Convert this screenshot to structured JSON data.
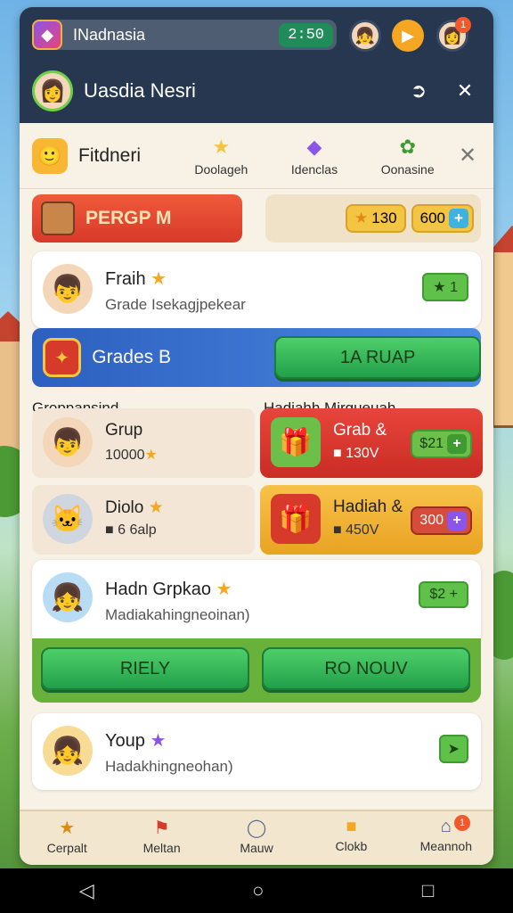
{
  "header": {
    "search_text": "INadnasia",
    "timer": "2:50",
    "notif_count": "1",
    "user_name": "Uasdia Nesri"
  },
  "tabs": {
    "main": "Fitdneri",
    "items": [
      "Doolageh",
      "Idenclas",
      "Oonasine"
    ]
  },
  "banner": {
    "group_label": "PERGP M",
    "stars": "130",
    "coins": "600"
  },
  "card1": {
    "name": "Fraih",
    "subtitle": "Grade Isekagjpekear",
    "badge": "1"
  },
  "strip": {
    "label": "Grades B",
    "button": "1A RUAP"
  },
  "sections": {
    "left": "Groppansind",
    "right": "Hadiahh Mirgueuah"
  },
  "grid": {
    "grup_title": "Grup",
    "grup_value": "10000",
    "diolo_title": "Diolo",
    "diolo_value": "6 6alp",
    "grab_title": "Grab &",
    "grab_value": "130V",
    "grab_pill": "$21",
    "hadiah_title": "Hadiah &",
    "hadiah_value": "450V",
    "hadiah_pill": "300"
  },
  "card2": {
    "name": "Hadn Grpkao",
    "subtitle": "Madiakahingneoinan)",
    "badge": "$2"
  },
  "buttons": {
    "left": "RIELY",
    "right": "RO NOUV"
  },
  "card3": {
    "name": "Youp",
    "subtitle": "Hadakhingneohan)"
  },
  "bottom_nav": {
    "items": [
      "Cerpalt",
      "Meltan",
      "Mauw",
      "Clokb",
      "Meannoh"
    ],
    "badge": "1"
  },
  "colors": {
    "header_bg": "#27374f",
    "panel_bg": "#f7f1e6",
    "accent_green": "#21a04a",
    "accent_red": "#d73a2a",
    "accent_gold": "#f4c542"
  }
}
